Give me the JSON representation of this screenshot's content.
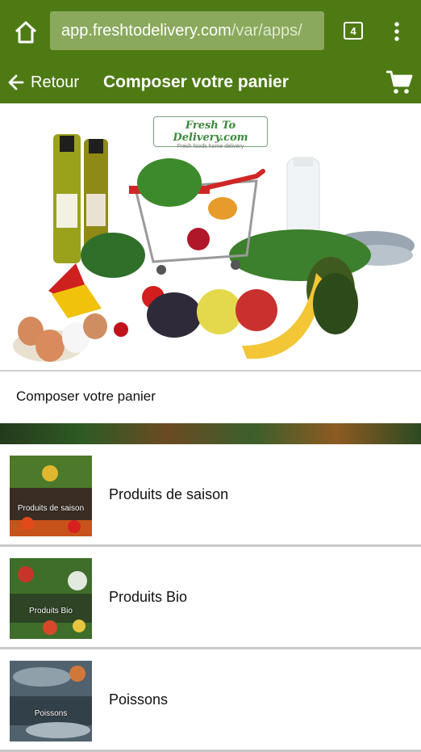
{
  "browser": {
    "url_host": "app.freshtodelivery.com",
    "url_path": "/var/apps/",
    "tab_count": "4",
    "icons": [
      "home-icon",
      "tabs-icon",
      "more-vert-icon"
    ]
  },
  "header": {
    "back_label": "Retour",
    "title": "Composer votre panier",
    "icons": [
      "arrow-left-icon",
      "cart-icon"
    ]
  },
  "banner": {
    "logo_title": "Fresh To Delivery.com",
    "logo_subtitle": "Fresh foods home delivery"
  },
  "section": {
    "title": "Composer votre panier"
  },
  "categories": [
    {
      "label": "Produits de saison",
      "thumb_caption": "Produits de saison"
    },
    {
      "label": "Produits Bio",
      "thumb_caption": "Produits Bio"
    },
    {
      "label": "Poissons",
      "thumb_caption": "Poissons"
    }
  ],
  "colors": {
    "brand_green": "#4e7a14",
    "url_box": "#8aa95c"
  }
}
